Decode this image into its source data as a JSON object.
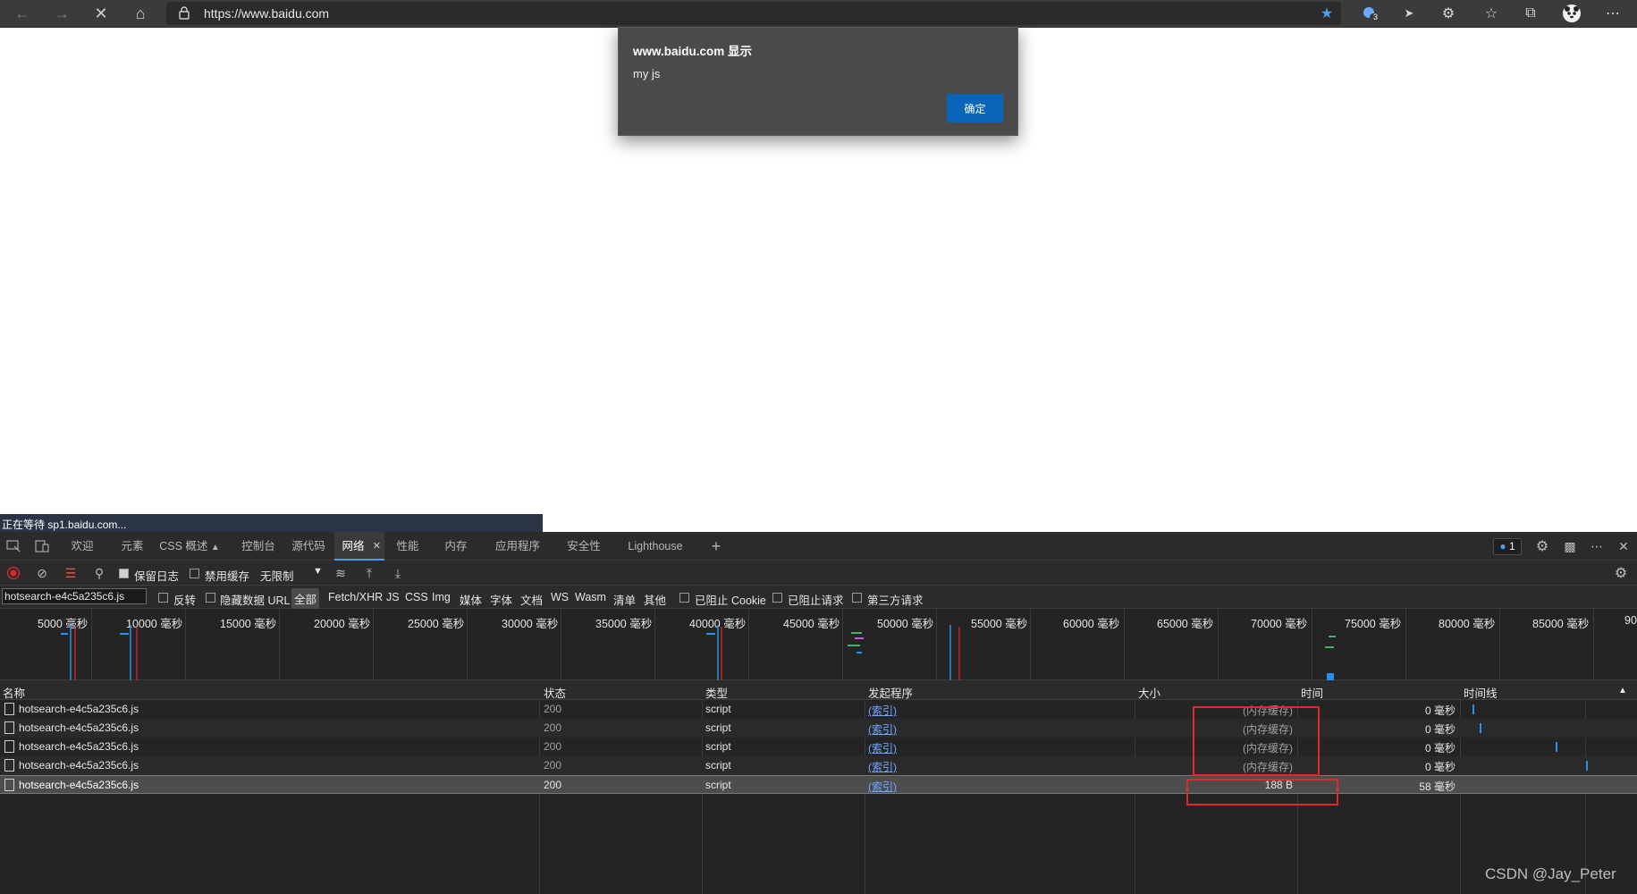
{
  "browser": {
    "url": "https://www.baidu.com",
    "profile_badge": "3"
  },
  "dialog": {
    "title": "www.baidu.com 显示",
    "message": "my js",
    "ok_label": "确定"
  },
  "status_text": "正在等待 sp1.baidu.com...",
  "devtools": {
    "tabs": [
      "欢迎",
      "元素",
      "CSS 概述",
      "控制台",
      "源代码",
      "网络",
      "性能",
      "内存",
      "应用程序",
      "安全性",
      "Lighthouse"
    ],
    "active_tab": "网络",
    "issue_count": "1",
    "toolbar": {
      "preserve_log": "保留日志",
      "disable_cache": "禁用缓存",
      "throttle": "无限制"
    },
    "filter": {
      "value": "hotsearch-e4c5a235c6.js",
      "invert": "反转",
      "hide_data_urls": "隐藏数据 URL",
      "types": [
        "全部",
        "Fetch/XHR",
        "JS",
        "CSS",
        "Img",
        "媒体",
        "字体",
        "文档",
        "WS",
        "Wasm",
        "清单",
        "其他"
      ],
      "blocked_cookies": "已阻止 Cookie",
      "blocked_requests": "已阻止请求",
      "third_party": "第三方请求"
    },
    "overview_ticks": [
      "5000 毫秒",
      "10000 毫秒",
      "15000 毫秒",
      "20000 毫秒",
      "25000 毫秒",
      "30000 毫秒",
      "35000 毫秒",
      "40000 毫秒",
      "45000 毫秒",
      "50000 毫秒",
      "55000 毫秒",
      "60000 毫秒",
      "65000 毫秒",
      "70000 毫秒",
      "75000 毫秒",
      "80000 毫秒",
      "85000 毫秒",
      "90"
    ],
    "columns": [
      "名称",
      "状态",
      "类型",
      "发起程序",
      "大小",
      "时间",
      "时间线"
    ],
    "rows": [
      {
        "name": "hotsearch-e4c5a235c6.js",
        "status": "200",
        "type": "script",
        "initiator": "(索引)",
        "size": "(内存缓存)",
        "time": "0 毫秒"
      },
      {
        "name": "hotsearch-e4c5a235c6.js",
        "status": "200",
        "type": "script",
        "initiator": "(索引)",
        "size": "(内存缓存)",
        "time": "0 毫秒"
      },
      {
        "name": "hotsearch-e4c5a235c6.js",
        "status": "200",
        "type": "script",
        "initiator": "(索引)",
        "size": "(内存缓存)",
        "time": "0 毫秒"
      },
      {
        "name": "hotsearch-e4c5a235c6.js",
        "status": "200",
        "type": "script",
        "initiator": "(索引)",
        "size": "(内存缓存)",
        "time": "0 毫秒"
      },
      {
        "name": "hotsearch-e4c5a235c6.js",
        "status": "200",
        "type": "script",
        "initiator": "(索引)",
        "size": "188 B",
        "time": "58 毫秒"
      }
    ]
  },
  "watermark": "CSDN @Jay_Peter",
  "colors": {
    "accent": "#0a64b8",
    "highlight": "#e0282d",
    "timeline_bar": "#2a8fe8"
  }
}
